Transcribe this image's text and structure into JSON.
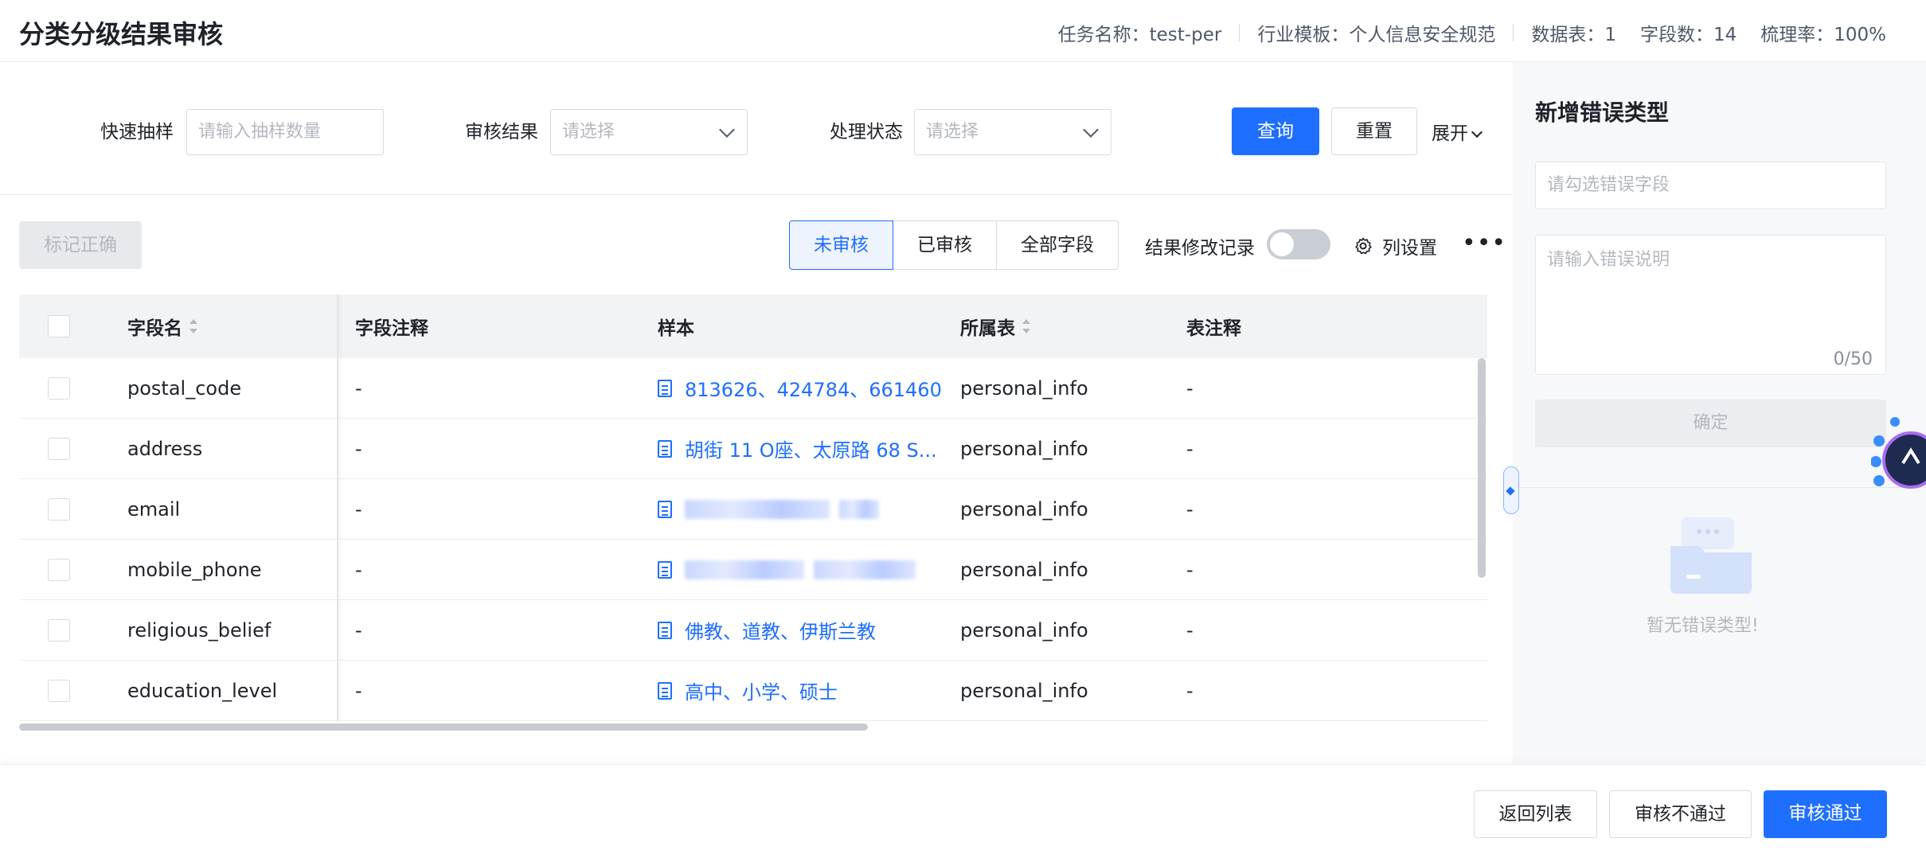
{
  "header": {
    "title": "分类分级结果审核",
    "task_name": "任务名称：test-per",
    "industry_template": "行业模板：个人信息安全规范",
    "table_count": "数据表：1",
    "field_count": "字段数：14",
    "coverage": "梳理率：100%"
  },
  "filters": {
    "quick_sample_label": "快速抽样",
    "quick_sample_placeholder": "请输入抽样数量",
    "review_result_label": "审核结果",
    "review_result_placeholder": "请选择",
    "process_status_label": "处理状态",
    "process_status_placeholder": "请选择",
    "query_button": "查询",
    "reset_button": "重置",
    "expand_link": "展开"
  },
  "toolbar": {
    "mark_correct_button": "标记正确",
    "tabs": [
      {
        "label": "未审核",
        "active": true
      },
      {
        "label": "已审核",
        "active": false
      },
      {
        "label": "全部字段",
        "active": false
      }
    ],
    "change_log_label": "结果修改记录",
    "change_log_enabled": false,
    "column_settings": "列设置",
    "more": "•••"
  },
  "table": {
    "columns": [
      "字段名",
      "字段注释",
      "样本",
      "所属表",
      "表注释"
    ],
    "rows": [
      {
        "field": "postal_code",
        "comment": "-",
        "sample": "813626、424784、661460",
        "sample_blurred": false,
        "table": "personal_info",
        "table_comment": "-"
      },
      {
        "field": "address",
        "comment": "-",
        "sample": "胡街 11 O座、太原路 68 S...",
        "sample_blurred": false,
        "table": "personal_info",
        "table_comment": "-"
      },
      {
        "field": "email",
        "comment": "-",
        "sample": "",
        "sample_blurred": true,
        "table": "personal_info",
        "table_comment": "-"
      },
      {
        "field": "mobile_phone",
        "comment": "-",
        "sample": "",
        "sample_blurred": true,
        "table": "personal_info",
        "table_comment": "-"
      },
      {
        "field": "religious_belief",
        "comment": "-",
        "sample": "佛教、道教、伊斯兰教",
        "sample_blurred": false,
        "table": "personal_info",
        "table_comment": "-"
      },
      {
        "field": "education_level",
        "comment": "-",
        "sample": "高中、小学、硕士",
        "sample_blurred": false,
        "table": "personal_info",
        "table_comment": "-"
      }
    ]
  },
  "right_panel": {
    "title": "新增错误类型",
    "field_placeholder": "请勾选错误字段",
    "desc_placeholder": "请输入错误说明",
    "char_count": "0/50",
    "confirm_button": "确定",
    "empty_text": "暂无错误类型!"
  },
  "footer": {
    "back_button": "返回列表",
    "reject_button": "审核不通过",
    "approve_button": "审核通过"
  },
  "colors": {
    "primary": "#1e6fff",
    "border": "#d9dbe0",
    "panel_bg": "#f7f8fa"
  }
}
